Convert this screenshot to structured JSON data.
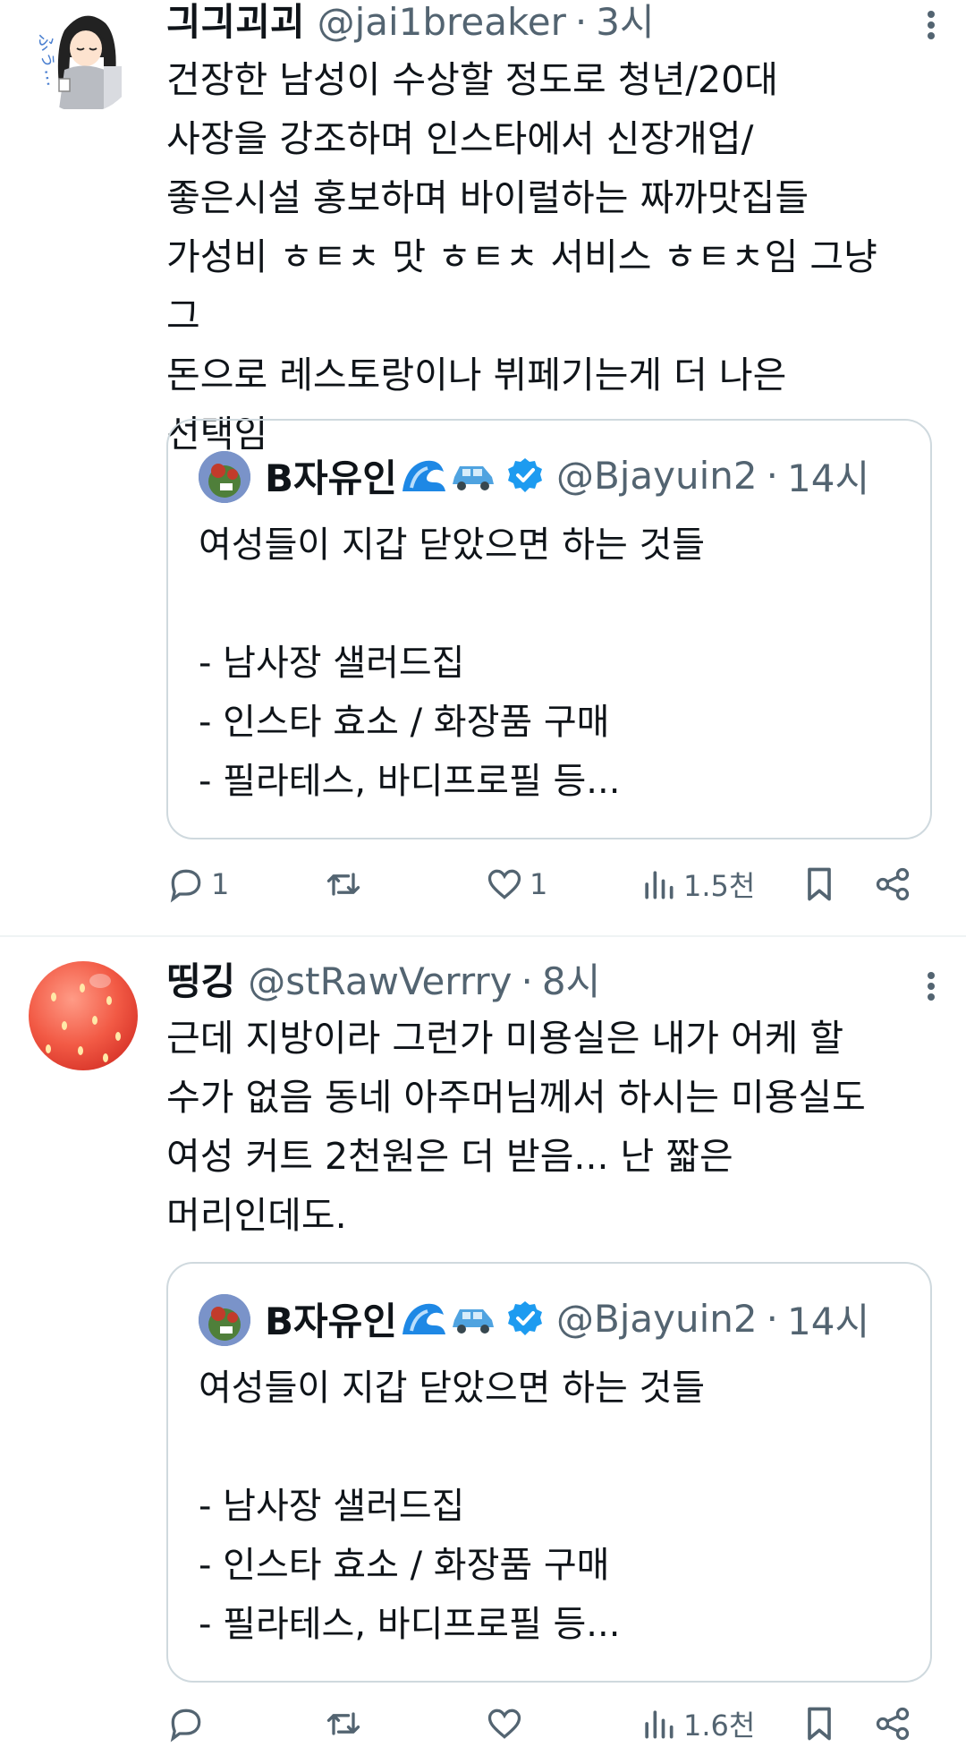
{
  "tweets": [
    {
      "display_name": "긔긔괴괴",
      "handle": "@jai1breaker",
      "separator": "·",
      "time": "3시",
      "text": "건장한 남성이 수상할 정도로 청년/20대\n사장을 강조하며 인스타에서 신장개업/\n좋은시설 홍보하며 바이럴하는 짜까맛집들\n가성비 ㅎㅌㅊ 맛 ㅎㅌㅊ 서비스 ㅎㅌㅊ임 그냥 그\n돈으로 레스토랑이나 뷔페기는게 더 나은\n선택임",
      "quote": {
        "display_name": "B자유인",
        "emojis": [
          "wave-emoji",
          "car-emoji"
        ],
        "handle": "@Bjayuin2",
        "separator": "·",
        "time": "14시",
        "text": "여성들이 지갑 닫았으면 하는 것들\n\n- 남사장 샐러드집\n- 인스타 효소 / 화장품 구매\n- 필라테스, 바디프로필 등..."
      },
      "actions": {
        "reply_count": "1",
        "retweet_count": "",
        "like_count": "1",
        "views_count": "1.5천"
      }
    },
    {
      "display_name": "띵깅",
      "handle": "@stRawVerrry",
      "separator": "·",
      "time": "8시",
      "text": "근데 지방이라 그런가 미용실은 내가 어케 할\n수가 없음 동네 아주머님께서 하시는 미용실도\n여성 커트 2천원은 더 받음... 난 짧은\n머리인데도.",
      "quote": {
        "display_name": "B자유인",
        "emojis": [
          "wave-emoji",
          "car-emoji"
        ],
        "handle": "@Bjayuin2",
        "separator": "·",
        "time": "14시",
        "text": "여성들이 지갑 닫았으면 하는 것들\n\n- 남사장 샐러드집\n- 인스타 효소 / 화장품 구매\n- 필라테스, 바디프로필 등..."
      },
      "actions": {
        "reply_count": "",
        "retweet_count": "",
        "like_count": "",
        "views_count": "1.6천"
      }
    }
  ],
  "colors": {
    "text_primary": "#0f1419",
    "text_secondary": "#536471",
    "border": "#cfd9de",
    "verified": "#1d9bf0"
  }
}
